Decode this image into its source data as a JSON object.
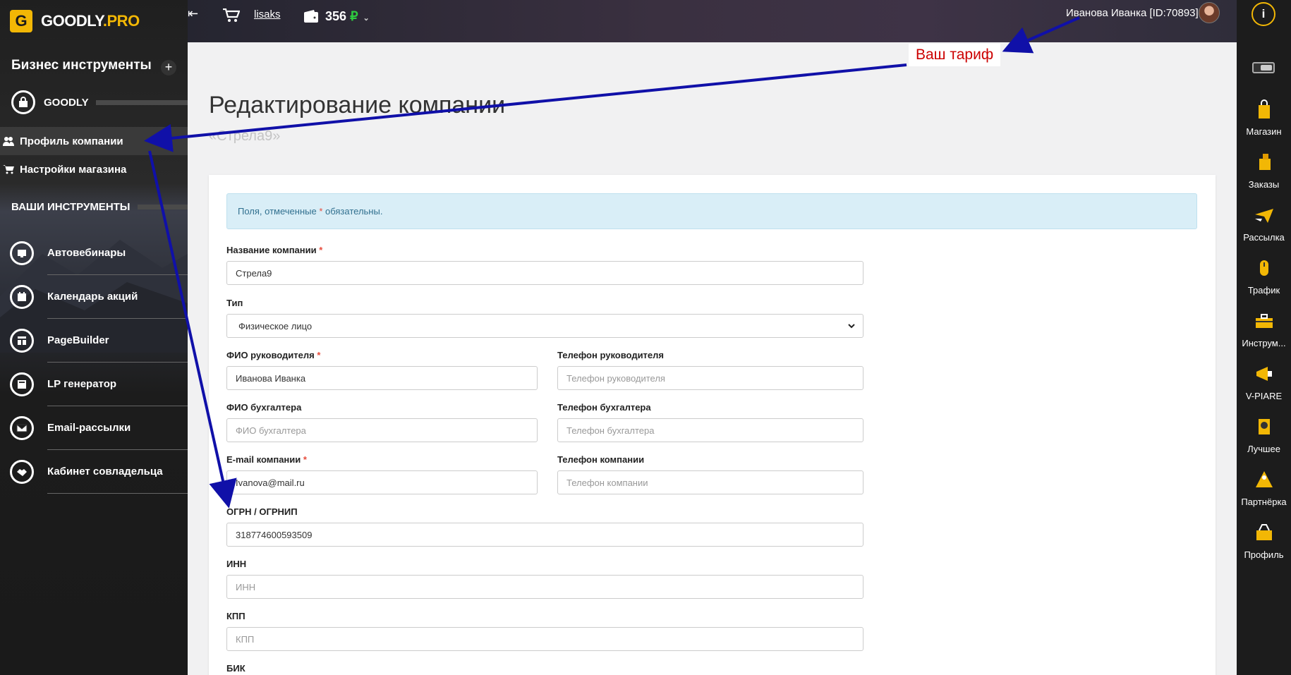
{
  "brand": {
    "logo_letter": "G",
    "name_main": "GOODLY",
    "name_suffix": ".PRO"
  },
  "sidebar": {
    "section_title": "Бизнес инструменты",
    "add_label": "+",
    "group_label": "GOODLY",
    "sub_items": [
      {
        "label": "Профиль компании",
        "active": true
      },
      {
        "label": "Настройки магазина",
        "active": false
      }
    ],
    "tools_title": "ВАШИ ИНСТРУМЕНТЫ",
    "tools": [
      {
        "label": "Автовебинары",
        "icon": "webinar-icon"
      },
      {
        "label": "Календарь акций",
        "icon": "calendar-icon"
      },
      {
        "label": "PageBuilder",
        "icon": "pagebuilder-icon"
      },
      {
        "label": "LP генератор",
        "icon": "lp-generator-icon"
      },
      {
        "label": "Email-рассылки",
        "icon": "email-icon"
      },
      {
        "label": "Кабинет совладельца",
        "icon": "handshake-icon"
      }
    ]
  },
  "topbar": {
    "shop_link": "lisaks",
    "balance_value": "356",
    "balance_currency": "₽",
    "user": "Иванова Иванка [ID:70893]"
  },
  "rail": {
    "info_label": "i",
    "items": [
      {
        "label": "Магазин",
        "icon": "shop-bag-icon"
      },
      {
        "label": "Заказы",
        "icon": "orders-box-icon"
      },
      {
        "label": "Рассылка",
        "icon": "mailing-plane-icon"
      },
      {
        "label": "Трафик",
        "icon": "traffic-mouse-icon"
      },
      {
        "label": "Инструм...",
        "icon": "tools-case-icon"
      },
      {
        "label": "V-PIARE",
        "icon": "megaphone-icon"
      },
      {
        "label": "Лучшее",
        "icon": "best-award-icon"
      },
      {
        "label": "Партнёрка",
        "icon": "partner-icon"
      },
      {
        "label": "Профиль",
        "icon": "profile-basket-icon"
      }
    ]
  },
  "page": {
    "title": "Редактирование компании",
    "subtitle": "«Стрела9»",
    "required_note_before": "Поля, отмеченные ",
    "required_note_star": "*",
    "required_note_after": " обязательны."
  },
  "form": {
    "company_name": {
      "label": "Название компании",
      "required": "*",
      "value": "Стрела9"
    },
    "type": {
      "label": "Тип",
      "value": "Физическое лицо"
    },
    "director_name": {
      "label": "ФИО руководителя",
      "required": "*",
      "value": "Иванова Иванка"
    },
    "director_phone": {
      "label": "Телефон руководителя",
      "placeholder": "Телефон руководителя"
    },
    "accountant_name": {
      "label": "ФИО бухгалтера",
      "placeholder": "ФИО бухгалтера"
    },
    "accountant_phone": {
      "label": "Телефон бухгалтера",
      "placeholder": "Телефон бухгалтера"
    },
    "company_email": {
      "label": "E-mail компании",
      "required": "*",
      "value": "Ivanova@mail.ru"
    },
    "company_phone": {
      "label": "Телефон компании",
      "placeholder": "Телефон компании"
    },
    "ogrn": {
      "label": "ОГРН / ОГРНИП",
      "value": "318774600593509"
    },
    "inn": {
      "label": "ИНН",
      "placeholder": "ИНН"
    },
    "kpp": {
      "label": "КПП",
      "placeholder": "КПП"
    },
    "bik": {
      "label": "БИК"
    }
  },
  "annotation": {
    "label": "Ваш тариф",
    "arrow_color": "#1010a8"
  }
}
